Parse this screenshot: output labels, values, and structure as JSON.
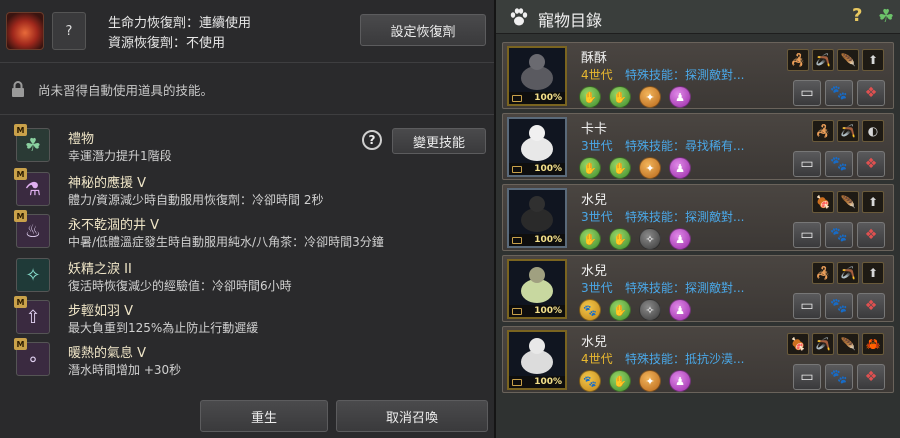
{
  "consumables": {
    "hp_line": "生命力恢復劑：連續使用",
    "res_line": "資源恢復劑：不使用",
    "empty_slot": "?",
    "setup_button": "設定恢復劑"
  },
  "notice": "尚未習得自動使用道具的技能。",
  "skills": [
    {
      "name": "禮物",
      "desc": "幸運潛力提升1階段",
      "badge": "M",
      "icon": "clover-icon"
    },
    {
      "name": "神秘的應援 V",
      "desc": "體力/資源減少時自動服用恢復劑：冷卻時間 2秒",
      "badge": "M",
      "icon": "potion-bottle-icon"
    },
    {
      "name": "永不乾涸的井 V",
      "desc": "中暑/低體溫症發生時自動服用純水/八角茶：冷卻時間3分鐘",
      "badge": "M",
      "icon": "bowl-icon"
    },
    {
      "name": "妖精之淚 II",
      "desc": "復活時恢復減少的經驗值：冷卻時間6小時",
      "badge": "",
      "icon": "fairy-tear-icon"
    },
    {
      "name": "步輕如羽 V",
      "desc": "最大負重到125%為止防止行動遲緩",
      "badge": "M",
      "icon": "weight-icon"
    },
    {
      "name": "暖熱的氣息 V",
      "desc": "潛水時間增加 +30秒",
      "badge": "M",
      "icon": "bubbles-icon"
    }
  ],
  "help_mark": "?",
  "change_skill_button": "變更技能",
  "bottom_buttons": {
    "rebirth": "重生",
    "cancel_summon": "取消召喚"
  },
  "pet_panel": {
    "title": "寵物目錄",
    "help": "?",
    "pets": [
      {
        "name": "酥酥",
        "gen": "4世代",
        "gen_color": "#e8b830",
        "skill": "特殊技能：探測敵對...",
        "pct": "100%",
        "orbs": [
          "green",
          "green",
          "orange",
          "purple"
        ],
        "traits": [
          "🦂",
          "🪃",
          "🪶",
          "⬆"
        ]
      },
      {
        "name": "卡卡",
        "gen": "3世代",
        "gen_color": "#4aa8e8",
        "skill": "特殊技能：尋找稀有...",
        "pct": "100%",
        "orbs": [
          "green",
          "green",
          "orange",
          "purple"
        ],
        "traits": [
          "🦂",
          "🪃",
          "◐"
        ]
      },
      {
        "name": "水兒",
        "gen": "3世代",
        "gen_color": "#4aa8e8",
        "skill": "特殊技能：探測敵對...",
        "pct": "100%",
        "orbs": [
          "green",
          "green",
          "gray",
          "purple"
        ],
        "traits": [
          "🍖",
          "🪶",
          "⬆"
        ]
      },
      {
        "name": "水兒",
        "gen": "3世代",
        "gen_color": "#4aa8e8",
        "skill": "特殊技能：探測敵對...",
        "pct": "100%",
        "orbs": [
          "gold",
          "green",
          "gray",
          "purple"
        ],
        "traits": [
          "🦂",
          "🪃",
          "⬆"
        ]
      },
      {
        "name": "水兒",
        "gen": "4世代",
        "gen_color": "#e8b830",
        "skill": "特殊技能：抵抗沙漠...",
        "pct": "100%",
        "orbs": [
          "gold",
          "green",
          "orange",
          "purple"
        ],
        "traits": [
          "🍖",
          "🪃",
          "🪶",
          "🦀"
        ]
      }
    ]
  }
}
